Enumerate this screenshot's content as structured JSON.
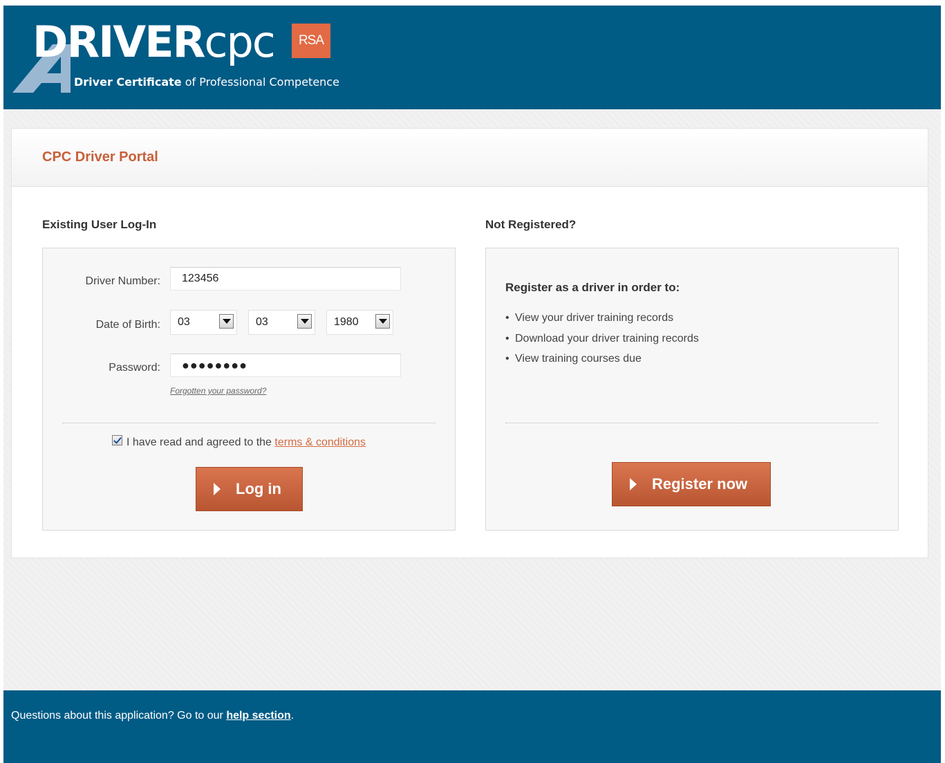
{
  "header": {
    "logo_word_bold": "DRIVER",
    "logo_word_light": "CPC",
    "logo_badge": "RSA",
    "tagline_bold": "Driver Certificate",
    "tagline_rest": "of Professional Competence",
    "colors": {
      "header_bg": "#005b85",
      "badge": "#e26a45"
    }
  },
  "portal": {
    "title": "CPC Driver Portal",
    "title_color": "#c8603a"
  },
  "login": {
    "section_title": "Existing User Log-In",
    "driver_number_label": "Driver Number:",
    "driver_number_value": "123456",
    "dob_label": "Date of Birth:",
    "dob_day": "03",
    "dob_month": "03",
    "dob_year": "1980",
    "password_label": "Password:",
    "password_masked": "●●●●●●●●",
    "forgot_link": "Forgotten your password?",
    "agree_checked": true,
    "agree_text": "I have read and agreed to the",
    "agree_link": "terms & conditions",
    "button_label": "Log in",
    "button_color": "#c8603a"
  },
  "register": {
    "section_title": "Not Registered?",
    "panel_title": "Register as a driver in order to:",
    "items": [
      "View your driver training records",
      "Download your driver training records",
      "View training courses due"
    ],
    "bullet": "•",
    "button_label": "Register now"
  },
  "footer": {
    "text": "Questions about this application? Go to our",
    "link": "help section",
    "suffix": "."
  }
}
